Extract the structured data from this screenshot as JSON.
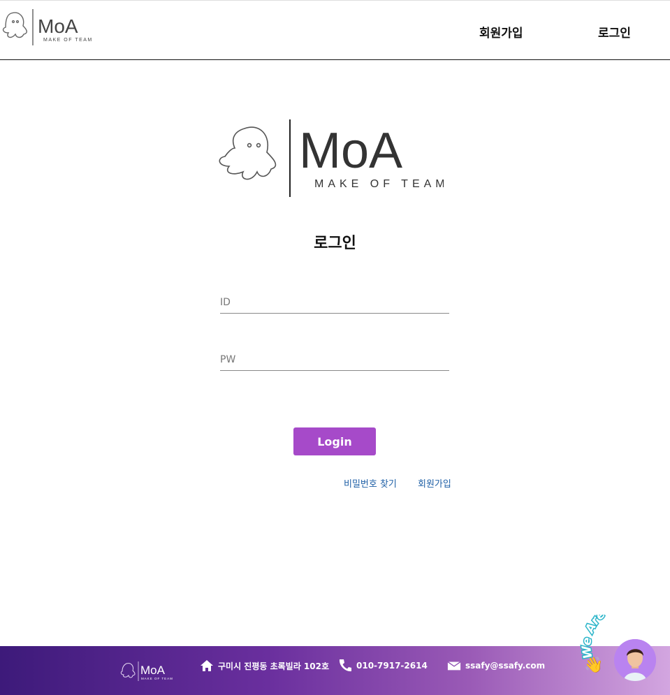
{
  "header": {
    "logo_text": "MoA",
    "logo_subtext": "MAKE OF TEAM",
    "nav": {
      "signup": "회원가입",
      "login": "로그인"
    }
  },
  "main": {
    "logo_text": "MoA",
    "logo_subtext": "MAKE OF TEAM",
    "title": "로그인",
    "id_placeholder": "ID",
    "pw_placeholder": "PW",
    "login_button": "Login",
    "links": {
      "find_password": "비밀번호 찾기",
      "signup": "회원가입"
    }
  },
  "footer": {
    "logo_text": "MoA",
    "logo_subtext": "MAKE OF TEAM",
    "address": "구미시 진평동 초록빌라 102호",
    "phone": "010-7917-2614",
    "email": "ssafy@ssafy.com",
    "badge_text": "We Are Here!"
  },
  "colors": {
    "accent": "#a64ac9",
    "link": "#1e5fa6",
    "footer_start": "#3d1a7a",
    "footer_end": "#d3a6e0"
  },
  "icons": [
    "octopus-icon",
    "home-icon",
    "phone-icon",
    "mail-icon",
    "wave-hand-icon"
  ]
}
